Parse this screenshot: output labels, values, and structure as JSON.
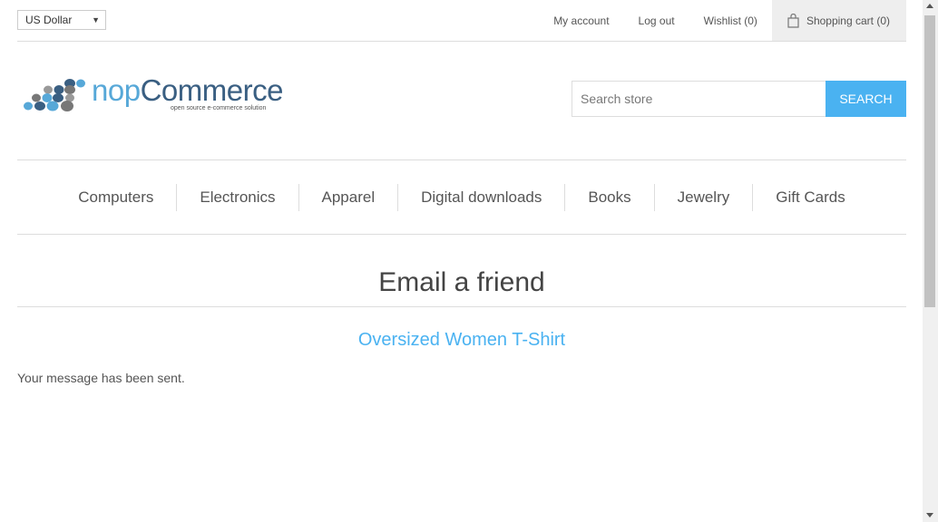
{
  "header": {
    "currency": "US Dollar",
    "links": {
      "my_account": "My account",
      "log_out": "Log out",
      "wishlist": "Wishlist (0)",
      "shopping_cart": "Shopping cart (0)"
    }
  },
  "logo": {
    "name_part1": "nop",
    "name_part2": "Commerce",
    "tagline": "open source e-commerce solution"
  },
  "search": {
    "placeholder": "Search store",
    "button_label": "SEARCH"
  },
  "menu": {
    "items": [
      {
        "label": "Computers"
      },
      {
        "label": "Electronics"
      },
      {
        "label": "Apparel"
      },
      {
        "label": "Digital downloads"
      },
      {
        "label": "Books"
      },
      {
        "label": "Jewelry"
      },
      {
        "label": "Gift Cards"
      }
    ]
  },
  "main": {
    "title": "Email a friend",
    "product_name": "Oversized Women T-Shirt",
    "result_message": "Your message has been sent."
  },
  "colors": {
    "accent": "#4ab2f1",
    "logo_dark": "#3a5f82"
  }
}
